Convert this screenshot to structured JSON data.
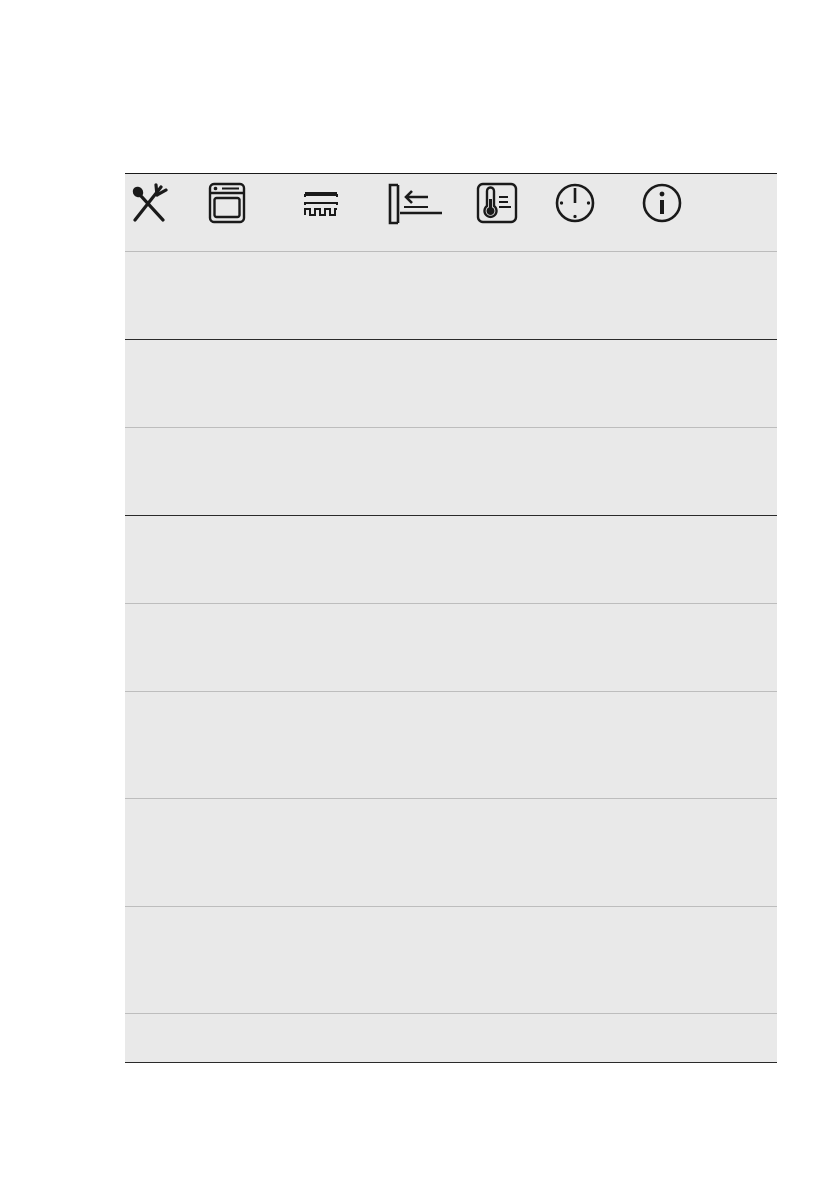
{
  "page": {
    "number": ""
  },
  "table": {
    "header_icons": [
      "cookware-icon",
      "oven-icon",
      "heating-function-icon",
      "shelf-position-icon",
      "temperature-icon",
      "time-icon",
      "info-icon"
    ],
    "rows": [
      {
        "dish": "",
        "note": ""
      },
      {
        "dish": "",
        "note": ""
      },
      {
        "dish": "",
        "note": ""
      },
      {
        "dish": "",
        "note": ""
      },
      {
        "dish": "",
        "note": ""
      },
      {
        "dish": "",
        "note": ""
      },
      {
        "dish": "",
        "note": ""
      },
      {
        "dish": "",
        "note": ""
      },
      {
        "dish": "",
        "note": ""
      }
    ]
  }
}
